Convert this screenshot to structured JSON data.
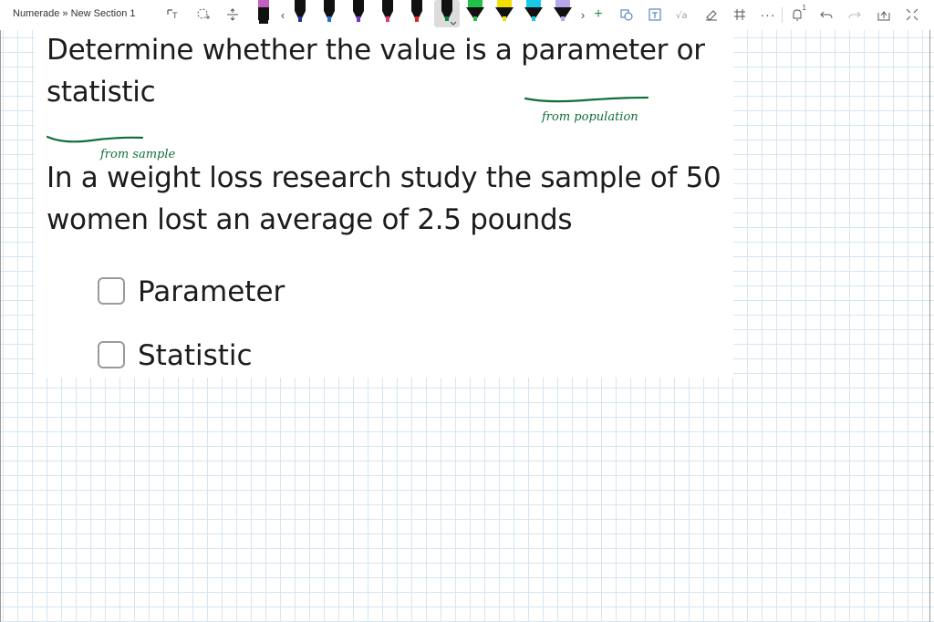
{
  "toolbar": {
    "breadcrumb": "Numerade » New Section 1",
    "pens": [
      {
        "name": "black-marker",
        "color": "#111111",
        "tip": "#222222"
      },
      {
        "name": "black-pen",
        "color": "#111111",
        "tip": "#1a3a8a"
      },
      {
        "name": "blue-pen",
        "color": "#1a1a1a",
        "tip": "#1e6fd9"
      },
      {
        "name": "purple-pen",
        "color": "#1a1a1a",
        "tip": "#7a33c8"
      },
      {
        "name": "pink-pen",
        "color": "#1a1a1a",
        "tip": "#e0367a"
      },
      {
        "name": "red-pen",
        "color": "#1a1a1a",
        "tip": "#e02424"
      },
      {
        "name": "green-pen",
        "color": "#1a1a1a",
        "tip": "#0e7a3c"
      },
      {
        "name": "green-highlighter",
        "color": "#22c24a",
        "tip": "#22c24a"
      },
      {
        "name": "yellow-highlighter",
        "color": "#f2e100",
        "tip": "#f2e100"
      },
      {
        "name": "cyan-highlighter",
        "color": "#19c8e6",
        "tip": "#19c8e6"
      },
      {
        "name": "lavender-highlighter",
        "color": "#b7a6ea",
        "tip": "#b7a6ea"
      }
    ],
    "notification_count": "1"
  },
  "question": {
    "line1": "Determine whether the value is a parameter or",
    "line2": "statistic",
    "body_line1": "In a weight loss research study the sample of 50",
    "body_line2": "women lost an average of 2.5 pounds"
  },
  "options": [
    {
      "label": "Parameter"
    },
    {
      "label": "Statistic"
    }
  ],
  "annotations": {
    "note_population": "from population",
    "note_sample": "from sample",
    "ink_color": "#0f6e3a"
  }
}
